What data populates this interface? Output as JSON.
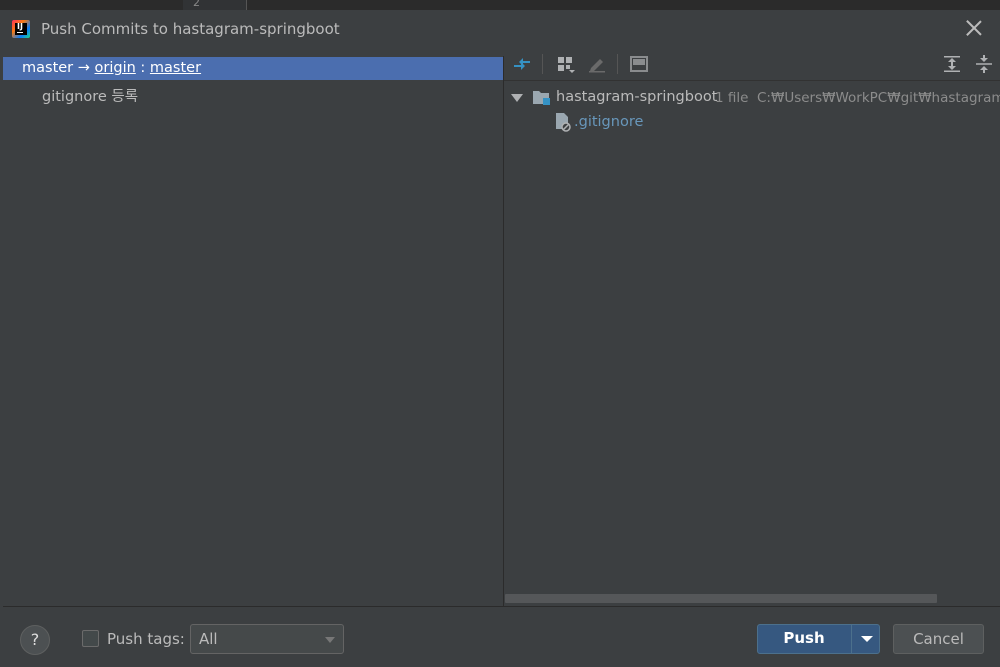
{
  "background": {
    "gutter_digit": "2"
  },
  "window": {
    "title": "Push Commits to hastagram-springboot"
  },
  "left": {
    "branch": {
      "local": "master",
      "arrow": " → ",
      "remote": "origin",
      "sep": " : ",
      "remote_branch": "master"
    },
    "commits": [
      {
        "message": "gitignore 등록"
      }
    ]
  },
  "right": {
    "tree": {
      "root": {
        "name": "hastagram-springboot",
        "count": "1 file",
        "path": "C:₩Users₩WorkPC₩git₩hastagram-s"
      },
      "children": [
        {
          "name": ".gitignore"
        }
      ]
    }
  },
  "footer": {
    "help": "?",
    "push_tags_label": "Push tags:",
    "push_tags_checked": false,
    "tags_select": "All",
    "push_label": "Push",
    "cancel_label": "Cancel"
  },
  "colors": {
    "selection": "#4b6eaf",
    "primary_button": "#365880",
    "link_file": "#6897bb",
    "secondary_text": "#8c8c8c",
    "folder_badge": "#3592c4"
  }
}
